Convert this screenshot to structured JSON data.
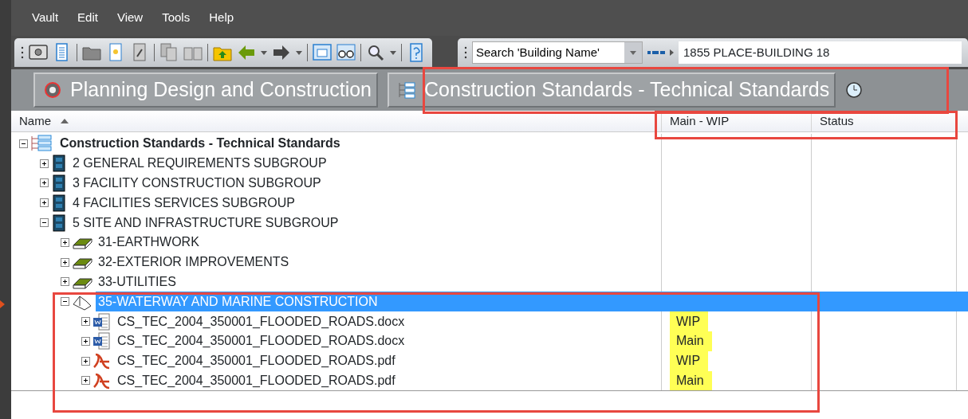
{
  "menu": [
    "Vault",
    "Edit",
    "View",
    "Tools",
    "Help"
  ],
  "search": {
    "value": "Search 'Building Name'"
  },
  "path": {
    "value": "1855 PLACE-BUILDING 18"
  },
  "tabs": [
    {
      "label": "Planning Design and Construction",
      "kind": "project"
    },
    {
      "label": "Construction Standards - Technical Standards",
      "kind": "list"
    }
  ],
  "table": {
    "columns": [
      "Name",
      "Main - WIP",
      "Status"
    ],
    "tree": [
      {
        "label": "Construction Standards - Technical Standards",
        "kind": "root",
        "expanded": true,
        "selected": false,
        "children": [
          {
            "label": "2 GENERAL REQUIREMENTS SUBGROUP",
            "kind": "cabinet",
            "expanded": false,
            "selected": false
          },
          {
            "label": "3 FACILITY CONSTRUCTION SUBGROUP",
            "kind": "cabinet",
            "expanded": false,
            "selected": false
          },
          {
            "label": "4 FACILITIES SERVICES SUBGROUP",
            "kind": "cabinet",
            "expanded": false,
            "selected": false
          },
          {
            "label": "5 SITE AND INFRASTRUCTURE SUBGROUP",
            "kind": "cabinet",
            "expanded": true,
            "selected": false,
            "children": [
              {
                "label": "31-EARTHWORK",
                "kind": "book",
                "expanded": false,
                "selected": false
              },
              {
                "label": "32-EXTERIOR IMPROVEMENTS",
                "kind": "book",
                "expanded": false,
                "selected": false
              },
              {
                "label": "33-UTILITIES",
                "kind": "book",
                "expanded": false,
                "selected": false
              },
              {
                "label": "35-WATERWAY AND MARINE CONSTRUCTION",
                "kind": "book",
                "expanded": true,
                "selected": true,
                "children": [
                  {
                    "label": "CS_TEC_2004_350001_FLOODED_ROADS.docx",
                    "kind": "docx",
                    "expanded": false,
                    "selected": false,
                    "main_wip": "WIP",
                    "highlighted": true
                  },
                  {
                    "label": "CS_TEC_2004_350001_FLOODED_ROADS.docx",
                    "kind": "docx",
                    "expanded": false,
                    "selected": false,
                    "main_wip": "Main",
                    "highlighted": true
                  },
                  {
                    "label": "CS_TEC_2004_350001_FLOODED_ROADS.pdf",
                    "kind": "pdf",
                    "expanded": false,
                    "selected": false,
                    "main_wip": "WIP",
                    "highlighted": true
                  },
                  {
                    "label": "CS_TEC_2004_350001_FLOODED_ROADS.pdf",
                    "kind": "pdf",
                    "expanded": false,
                    "selected": false,
                    "main_wip": "Main",
                    "highlighted": true
                  }
                ]
              }
            ]
          }
        ]
      }
    ]
  }
}
